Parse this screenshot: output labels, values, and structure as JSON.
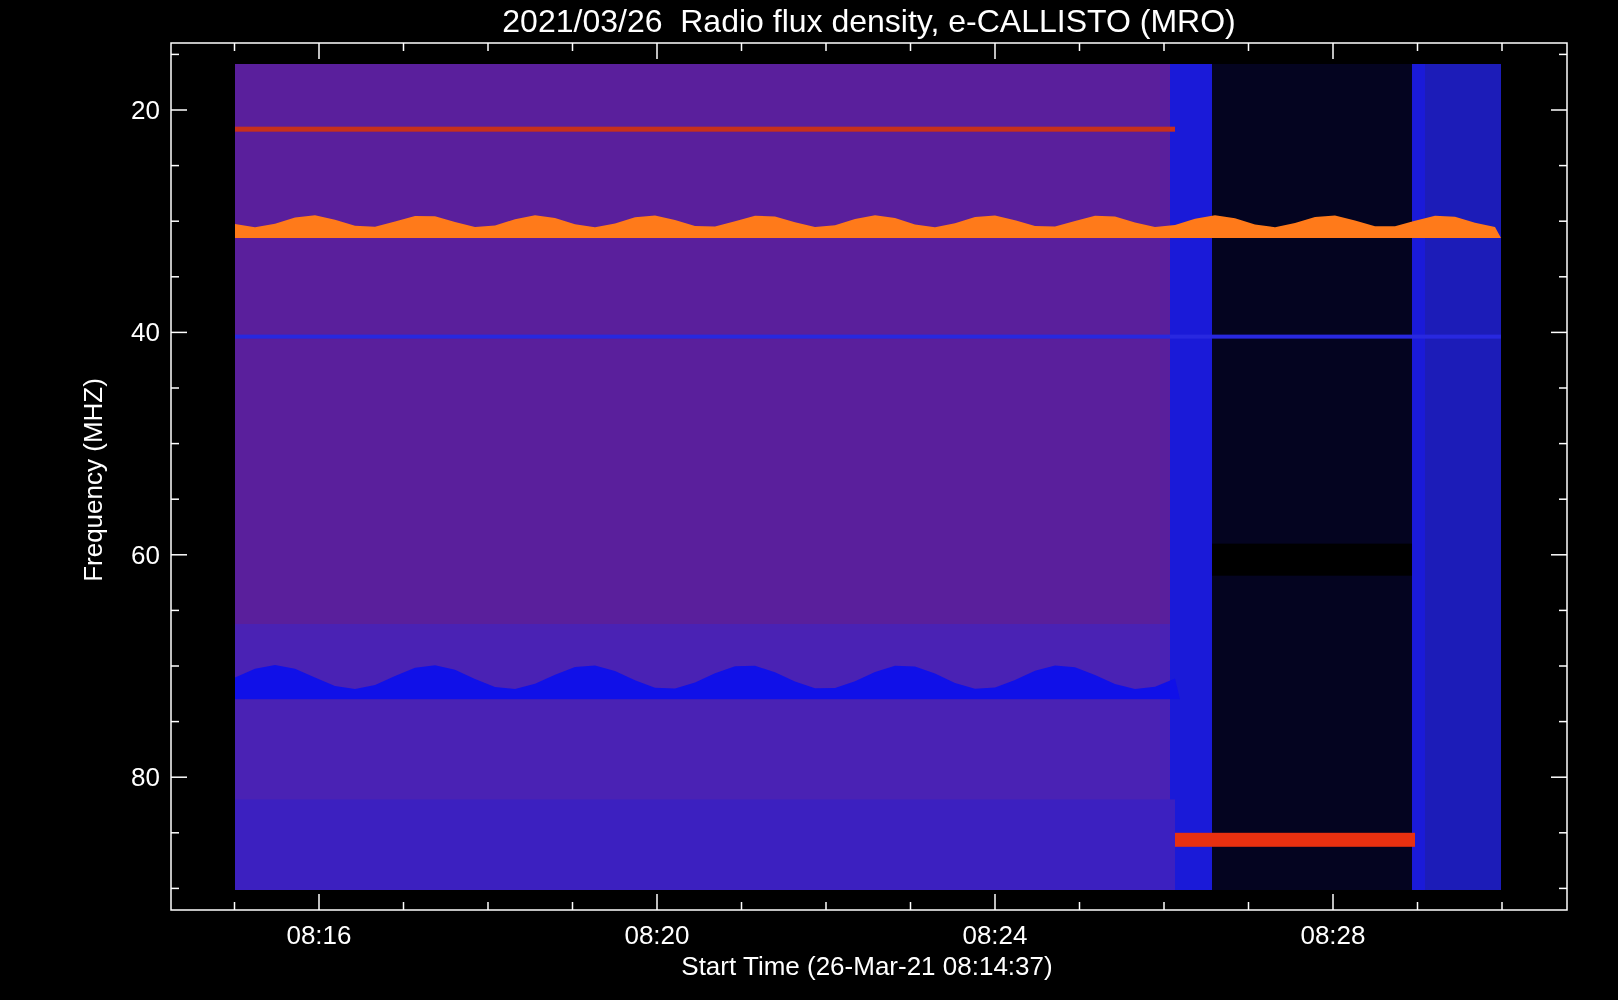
{
  "title": "2021/03/26  Radio flux density, e-CALLISTO (MRO)",
  "y_axis": {
    "label": "Frequency (MHZ)",
    "ticks": [
      "20",
      "40",
      "60",
      "80"
    ]
  },
  "x_axis": {
    "label": "Start Time (26-Mar-21 08:14:37)",
    "ticks": [
      "08:16",
      "08:20",
      "08:24",
      "08:28"
    ]
  }
}
